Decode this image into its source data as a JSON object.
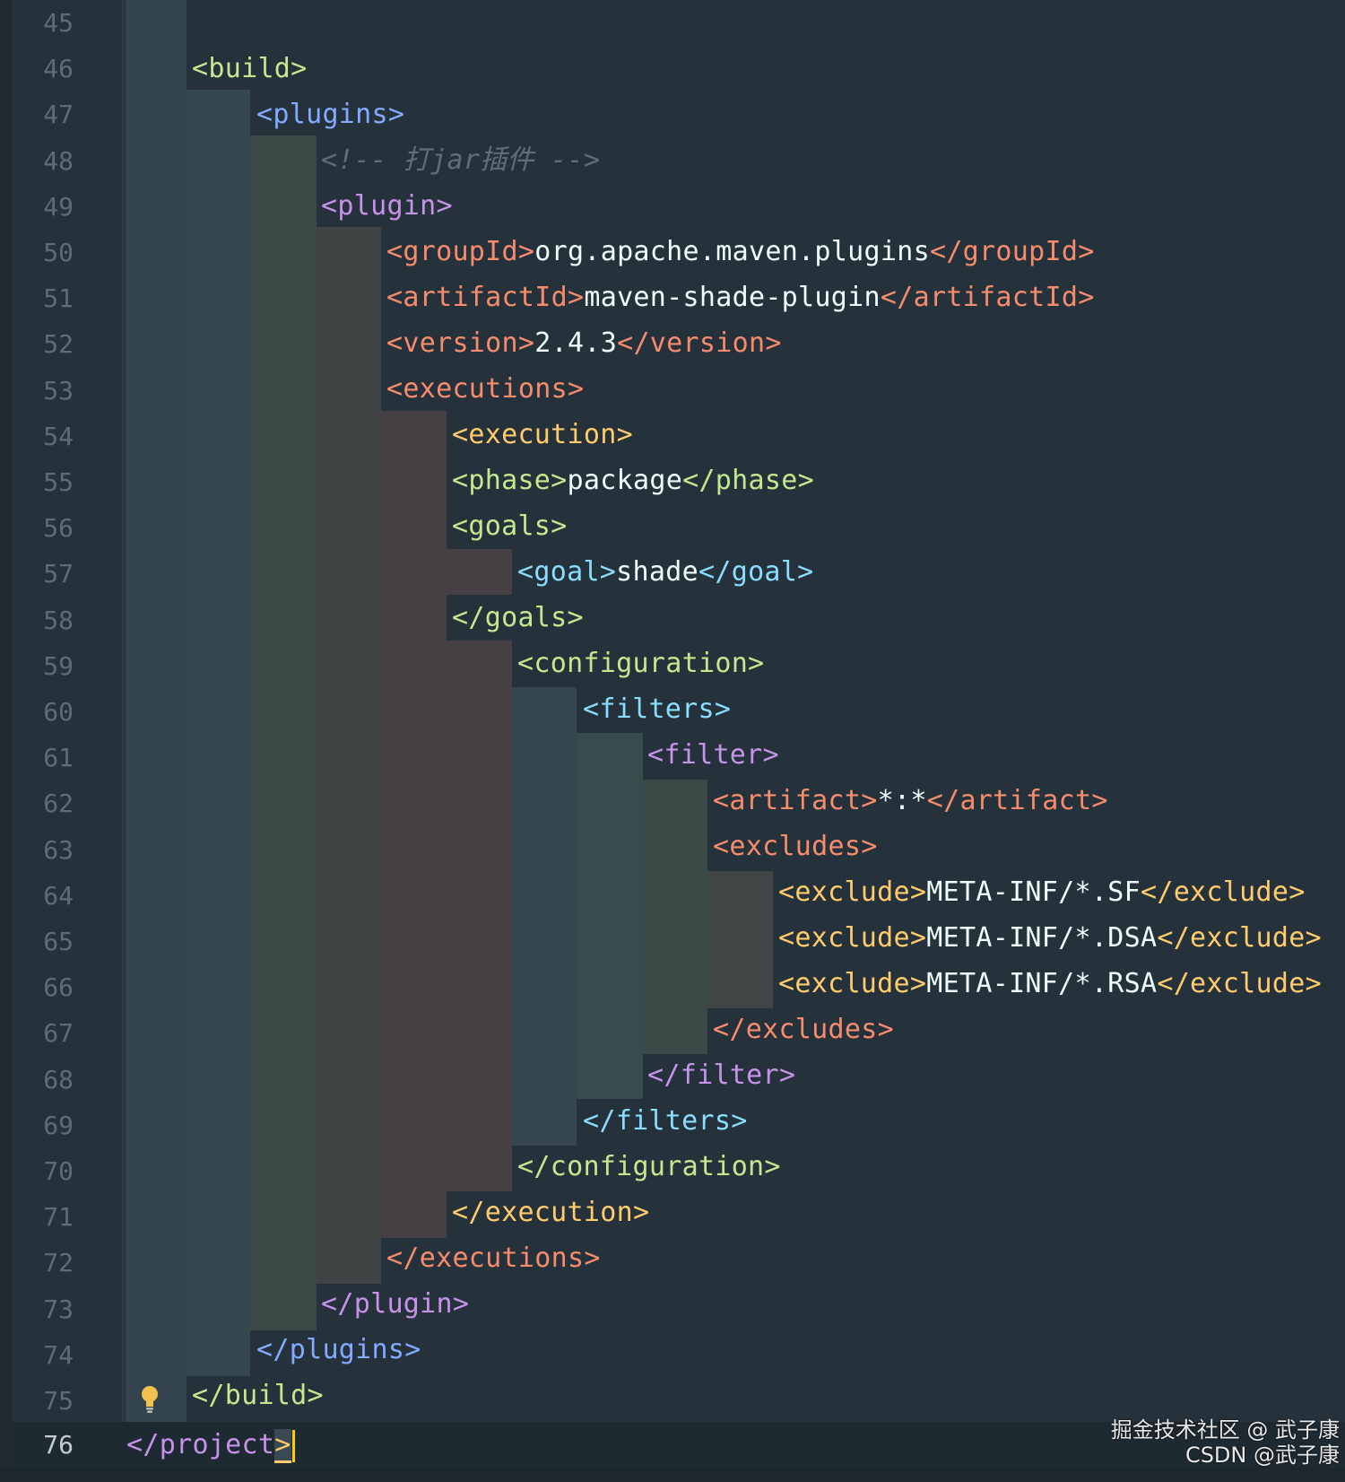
{
  "editor": {
    "line_numbers": [
      "45",
      "46",
      "47",
      "48",
      "49",
      "50",
      "51",
      "52",
      "53",
      "54",
      "55",
      "56",
      "57",
      "58",
      "59",
      "60",
      "61",
      "62",
      "63",
      "64",
      "65",
      "66",
      "67",
      "68",
      "69",
      "70",
      "71",
      "72",
      "73",
      "74",
      "75",
      "76"
    ],
    "lines": {
      "l46": {
        "open": "<build>"
      },
      "l47": {
        "open": "<plugins>"
      },
      "l48": {
        "comment": "<!-- 打jar插件 -->"
      },
      "l49": {
        "open": "<plugin>"
      },
      "l50": {
        "open": "<groupId>",
        "text": "org.apache.maven.plugins",
        "close": "</groupId>"
      },
      "l51": {
        "open": "<artifactId>",
        "text": "maven-shade-plugin",
        "close": "</artifactId>"
      },
      "l52": {
        "open": "<version>",
        "text": "2.4.3",
        "close": "</version>"
      },
      "l53": {
        "open": "<executions>"
      },
      "l54": {
        "open": "<execution>"
      },
      "l55": {
        "open": "<phase>",
        "text": "package",
        "close": "</phase>"
      },
      "l56": {
        "open": "<goals>"
      },
      "l57": {
        "open": "<goal>",
        "text": "shade",
        "close": "</goal>"
      },
      "l58": {
        "close": "</goals>"
      },
      "l59": {
        "open": "<configuration>"
      },
      "l60": {
        "open": "<filters>"
      },
      "l61": {
        "open": "<filter>"
      },
      "l62": {
        "open": "<artifact>",
        "text": "*:*",
        "close": "</artifact>"
      },
      "l63": {
        "open": "<excludes>"
      },
      "l64": {
        "open": "<exclude>",
        "text": "META-INF/*.SF",
        "close": "</exclude>"
      },
      "l65": {
        "open": "<exclude>",
        "text": "META-INF/*.DSA",
        "close": "</exclude>"
      },
      "l66": {
        "open": "<exclude>",
        "text": "META-INF/*.RSA",
        "close": "</exclude>"
      },
      "l67": {
        "close": "</excludes>"
      },
      "l68": {
        "close": "</filter>"
      },
      "l69": {
        "close": "</filters>"
      },
      "l70": {
        "close": "</configuration>"
      },
      "l71": {
        "close": "</execution>"
      },
      "l72": {
        "close": "</executions>"
      },
      "l73": {
        "close": "</plugin>"
      },
      "l74": {
        "close": "</plugins>"
      },
      "l75": {
        "close": "</build>"
      },
      "l76": {
        "close_a": "</project",
        "close_b": ">"
      }
    }
  },
  "watermark": {
    "line1": "掘金技术社区 @ 武子康",
    "line2": "CSDN @武子康"
  },
  "icons": {
    "intention": "lightbulb-icon"
  },
  "colors": {
    "background": "#26323b",
    "tag_orange": "#f78c6c",
    "tag_yellow": "#ffcb6b",
    "tag_green": "#c3e88d",
    "tag_blue": "#82aaff",
    "tag_violet": "#c792ea",
    "cursor": "#ffcc00"
  }
}
